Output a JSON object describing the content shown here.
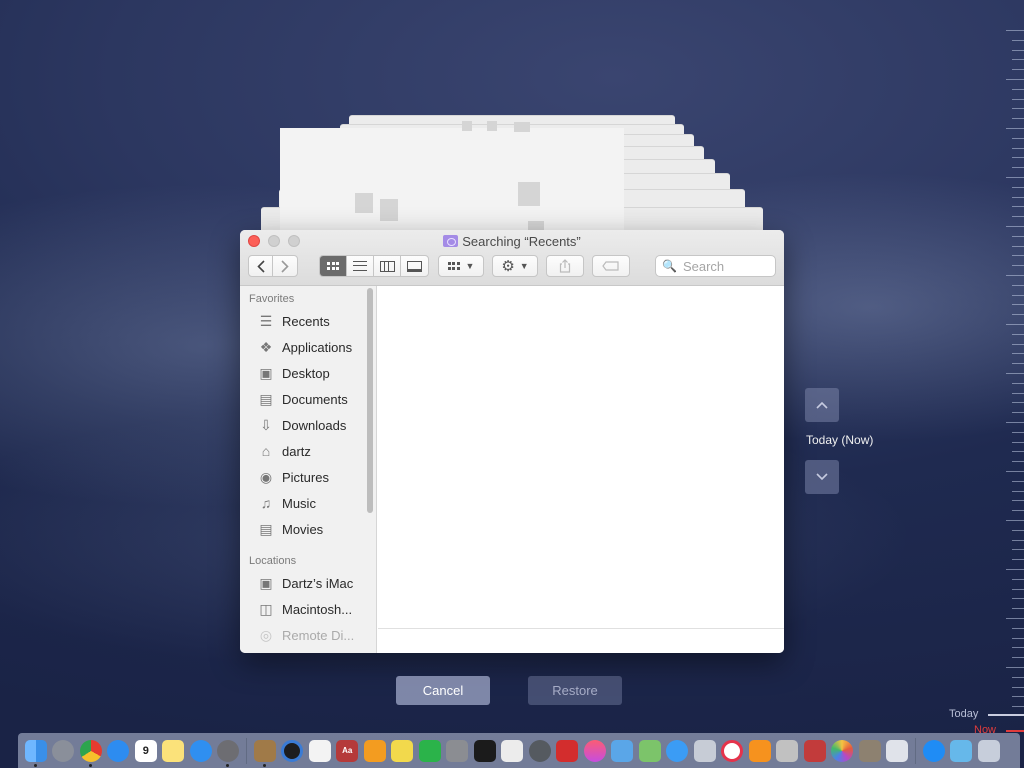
{
  "finder": {
    "title": "Searching “Recents”",
    "search_placeholder": "Search",
    "sidebar": {
      "favorites_header": "Favorites",
      "favorites": [
        {
          "label": "Recents",
          "icon": "recents-icon"
        },
        {
          "label": "Applications",
          "icon": "applications-icon"
        },
        {
          "label": "Desktop",
          "icon": "desktop-icon"
        },
        {
          "label": "Documents",
          "icon": "documents-icon"
        },
        {
          "label": "Downloads",
          "icon": "downloads-icon"
        },
        {
          "label": "dartz",
          "icon": "home-icon"
        },
        {
          "label": "Pictures",
          "icon": "pictures-icon"
        },
        {
          "label": "Music",
          "icon": "music-icon"
        },
        {
          "label": "Movies",
          "icon": "movies-icon"
        }
      ],
      "locations_header": "Locations",
      "locations": [
        {
          "label": "Dartz’s iMac",
          "icon": "imac-icon"
        },
        {
          "label": "Macintosh...",
          "icon": "disk-icon"
        },
        {
          "label": "Remote Di...",
          "icon": "remote-disc-icon"
        }
      ]
    }
  },
  "time_machine": {
    "date_label": "Today (Now)",
    "cancel_label": "Cancel",
    "restore_label": "Restore",
    "timeline_today": "Today",
    "timeline_now": "Now"
  },
  "colors": {
    "close_button": "#fc5f57",
    "accent_now": "#e03c3c"
  }
}
